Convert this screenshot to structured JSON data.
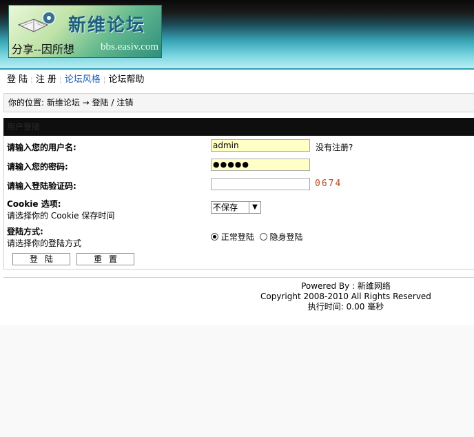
{
  "logo": {
    "title": "新维论坛",
    "slogan": "分享--因所想",
    "domain": "bbs.easiv.com"
  },
  "nav": {
    "login": "登 陆",
    "register": "注 册",
    "style": "论坛风格",
    "help": "论坛帮助"
  },
  "breadcrumb": "你的位置: 新维论坛 → 登陆 / 注销",
  "panel": {
    "title": "用户登陆"
  },
  "form": {
    "username_label": "请输入您的用户名:",
    "username_value": "admin",
    "no_account": "没有注册?",
    "password_label": "请输入您的密码:",
    "password_value": "●●●●●",
    "captcha_label": "请输入登陆验证码:",
    "captcha_code": "0674",
    "cookie_label": "Cookie 选项:",
    "cookie_desc": "请选择你的 Cookie 保存时间",
    "cookie_selected": "不保存",
    "mode_label": "登陆方式:",
    "mode_desc": "请选择你的登陆方式",
    "mode_normal": "正常登陆",
    "mode_hidden": "隐身登陆",
    "submit_label": "登陆",
    "reset_label": "重置"
  },
  "footer": {
    "powered": "Powered By : 新维网络",
    "copyright": "Copyright 2008-2010 All Rights Reserved",
    "exec_time": "执行时间: 0.00 毫秒"
  },
  "colors": {
    "header_dark": "#0a0a0a",
    "header_teal": "#3aa7b8",
    "input_yellow": "#ffffc6",
    "captcha": "#b34a1c",
    "link_active": "#1f5fb4"
  }
}
